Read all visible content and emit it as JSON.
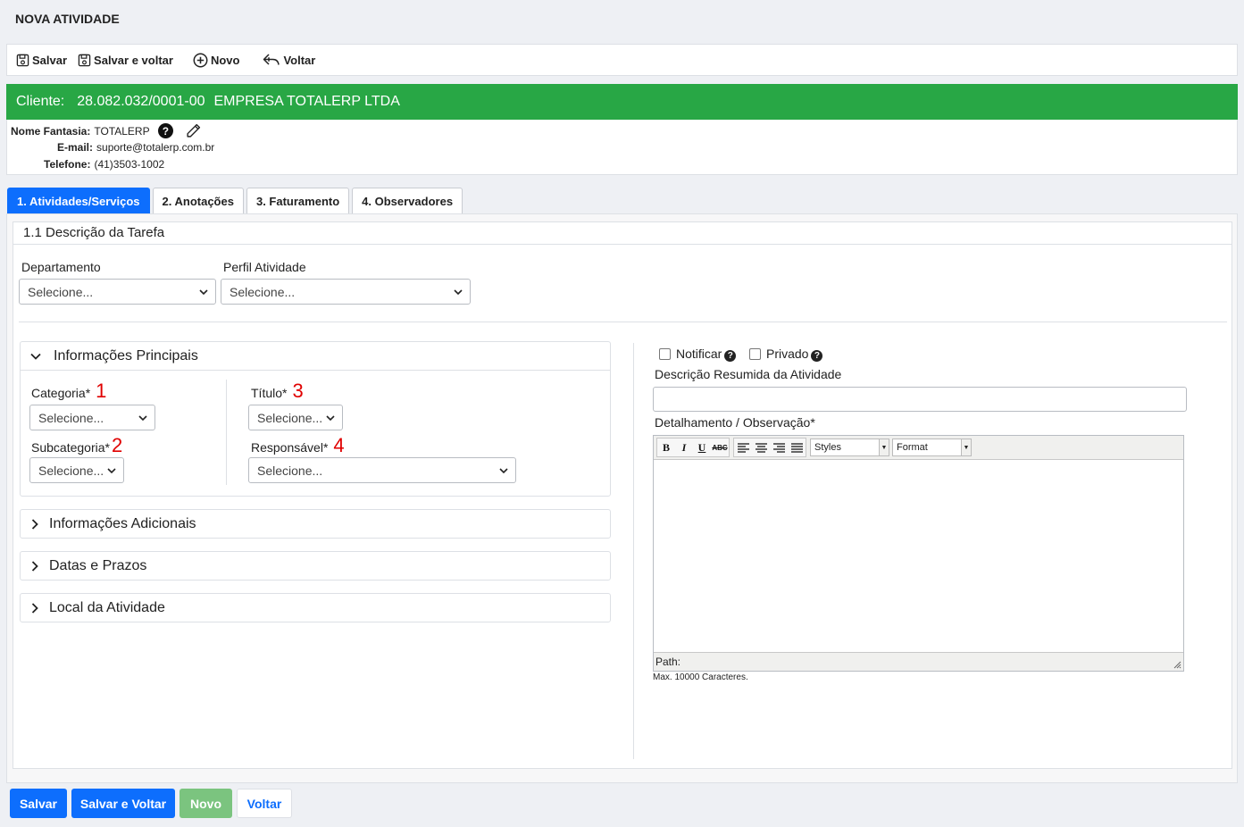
{
  "page": {
    "title": "NOVA ATIVIDADE"
  },
  "toolbar": {
    "save_label": "Salvar",
    "save_back_label": "Salvar e voltar",
    "new_label": "Novo",
    "back_label": "Voltar"
  },
  "client": {
    "label": "Cliente:",
    "cnpj": "28.082.032/0001-00",
    "name": "EMPRESA TOTALERP LTDA",
    "fantasy_label": "Nome Fantasia:",
    "fantasy_value": "TOTALERP",
    "email_label": "E-mail:",
    "email_value": "suporte@totalerp.com.br",
    "phone_label": "Telefone:",
    "phone_value": "(41)3503-1002"
  },
  "tabs": [
    {
      "label": "1. Atividades/Serviços",
      "active": true
    },
    {
      "label": "2. Anotações",
      "active": false
    },
    {
      "label": "3. Faturamento",
      "active": false
    },
    {
      "label": "4. Observadores",
      "active": false
    }
  ],
  "section": {
    "title": "1.1 Descrição da Tarefa"
  },
  "top_fields": {
    "departamento_label": "Departamento",
    "departamento_value": "Selecione...",
    "perfil_label": "Perfil Atividade",
    "perfil_value": "Selecione..."
  },
  "panels": {
    "principal": {
      "title": "Informações Principais",
      "categoria_label": "Categoria*",
      "categoria_num": "1",
      "categoria_value": "Selecione...",
      "subcategoria_label": "Subcategoria*",
      "subcategoria_num": "2",
      "subcategoria_value": "Selecione...",
      "titulo_label": "Título*",
      "titulo_num": "3",
      "titulo_value": "Selecione...",
      "responsavel_label": "Responsável*",
      "responsavel_num": "4",
      "responsavel_value": "Selecione..."
    },
    "adicionais": {
      "title": "Informações Adicionais"
    },
    "datas": {
      "title": "Datas e Prazos"
    },
    "local": {
      "title": "Local da Atividade"
    }
  },
  "right": {
    "notificar_label": "Notificar",
    "privado_label": "Privado",
    "descricao_label": "Descrição Resumida da Atividade",
    "detalhamento_label": "Detalhamento / Observação*",
    "editor_styles": "Styles",
    "editor_format": "Format",
    "editor_path": "Path:",
    "max_chars": "Max. 10000 Caracteres."
  },
  "bottom": {
    "save_label": "Salvar",
    "save_back_label": "Salvar e Voltar",
    "new_label": "Novo",
    "back_label": "Voltar"
  },
  "colors": {
    "primary": "#0d6efd",
    "client_bar": "#28a745",
    "new_button": "#7bc47f",
    "annotation_red": "#e00000"
  }
}
